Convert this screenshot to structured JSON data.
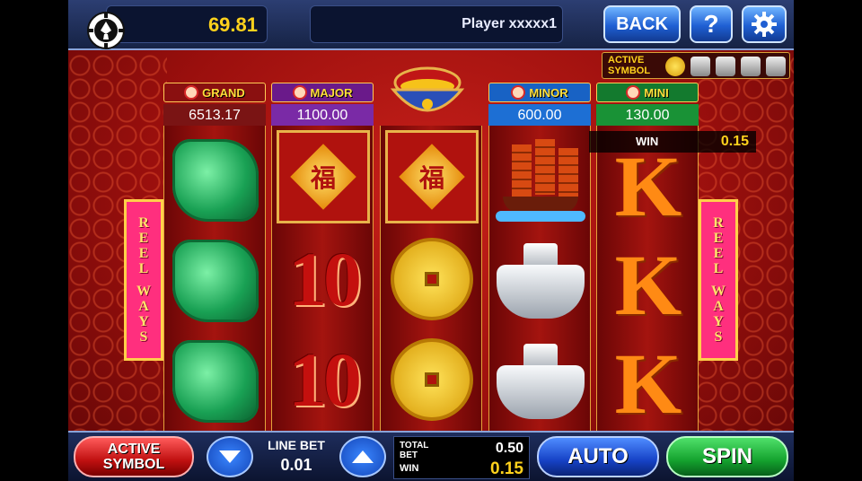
{
  "header": {
    "balance": "69.81",
    "player": "Player xxxxx1",
    "back_label": "BACK",
    "help_label": "?"
  },
  "active_symbol_panel": {
    "label": "ACTIVE SYMBOL"
  },
  "jackpots": {
    "grand": {
      "label": "GRAND",
      "value": "6513.17"
    },
    "major": {
      "label": "MAJOR",
      "value": "1100.00"
    },
    "minor": {
      "label": "MINOR",
      "value": "600.00"
    },
    "mini": {
      "label": "MINI",
      "value": "130.00"
    }
  },
  "win_overlay": {
    "label": "WIN",
    "value": "0.15"
  },
  "reels": [
    [
      "jade-phoenix",
      "jade-phoenix",
      "jade-phoenix"
    ],
    [
      "fu-tile",
      "10",
      "10"
    ],
    [
      "fu-tile",
      "gold-coin",
      "gold-coin"
    ],
    [
      "junk-ship",
      "silver-ingot",
      "silver-ingot"
    ],
    [
      "K",
      "K",
      "K"
    ]
  ],
  "symbols": {
    "ten": "10",
    "k": "K",
    "fu": "福"
  },
  "reel_ways": {
    "left": [
      "R",
      "E",
      "E",
      "L",
      "",
      "W",
      "A",
      "Y",
      "S"
    ],
    "text": "REEL WAYS"
  },
  "footer": {
    "active_symbol_label": "ACTIVE SYMBOL",
    "line_bet_label": "LINE BET",
    "line_bet_value": "0.01",
    "total_bet_label": "TOTAL BET",
    "total_bet_value": "0.50",
    "win_label": "WIN",
    "win_value": "0.15",
    "auto_label": "AUTO",
    "spin_label": "SPIN"
  },
  "colors": {
    "accent_gold": "#ffd21c",
    "reel_red": "#a4140f",
    "spin_green": "#14a22e",
    "auto_blue": "#1642c6"
  }
}
